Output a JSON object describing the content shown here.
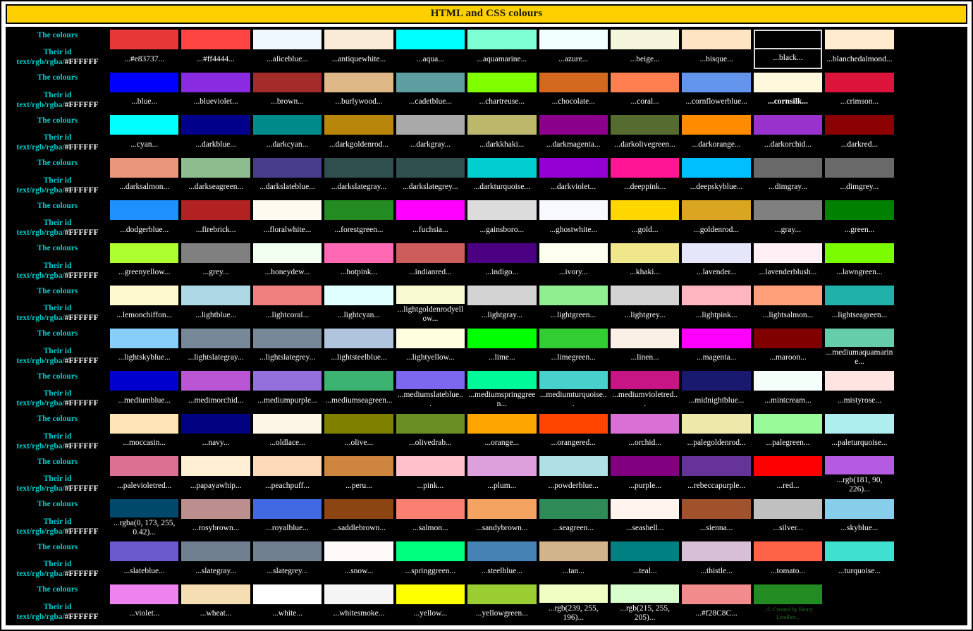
{
  "title": "HTML and CSS colours",
  "row_labels": {
    "line1": "The colours",
    "line2": "Their id",
    "line3_prefix": "text/rgb/rgba/",
    "line3_hex": "#FFFFFF"
  },
  "accents": {
    "title_bg": "#FFD000",
    "label_color": "#00CCCC",
    "table_bg": "#000000",
    "caption_color": "#FFFFFF",
    "selected_border": "#DDDDDD",
    "copyright_text_color": "#1e7a1e"
  },
  "columns_per_row": 12,
  "rows": [
    {
      "cells": [
        {
          "label": "...#e83737...",
          "color": "#e83737"
        },
        {
          "label": "...#ff4444...",
          "color": "#ff4444"
        },
        {
          "label": "...aliceblue...",
          "color": "#f0f8ff"
        },
        {
          "label": "...antiquewhite...",
          "color": "#faebd7"
        },
        {
          "label": "...aqua...",
          "color": "#00ffff"
        },
        {
          "label": "...aquamarine...",
          "color": "#7fffd4"
        },
        {
          "label": "...azure...",
          "color": "#f0ffff"
        },
        {
          "label": "...beige...",
          "color": "#f5f5dc"
        },
        {
          "label": "...bisque...",
          "color": "#ffe4c4"
        },
        {
          "label": "...black...",
          "color": "#000000",
          "selected": true
        },
        {
          "label": "...blanchedalmond...",
          "color": "#ffebcd"
        }
      ]
    },
    {
      "cells": [
        {
          "label": "...blue...",
          "color": "#0000ff"
        },
        {
          "label": "...blueviolet...",
          "color": "#8a2be2"
        },
        {
          "label": "...brown...",
          "color": "#a52a2a"
        },
        {
          "label": "...burlywood...",
          "color": "#deb887"
        },
        {
          "label": "...cadetblue...",
          "color": "#5f9ea0"
        },
        {
          "label": "...chartreuse...",
          "color": "#7fff00"
        },
        {
          "label": "...chocolate...",
          "color": "#d2691e"
        },
        {
          "label": "...coral...",
          "color": "#ff7f50"
        },
        {
          "label": "...cornflowerblue...",
          "color": "#6495ed"
        },
        {
          "label": "...cornsilk...",
          "color": "#fff8dc",
          "bold": true
        },
        {
          "label": "...crimson...",
          "color": "#dc143c"
        }
      ]
    },
    {
      "cells": [
        {
          "label": "...cyan...",
          "color": "#00ffff"
        },
        {
          "label": "...darkblue...",
          "color": "#00008b"
        },
        {
          "label": "...darkcyan...",
          "color": "#008b8b"
        },
        {
          "label": "...darkgoldenrod...",
          "color": "#b8860b"
        },
        {
          "label": "...darkgray...",
          "color": "#a9a9a9"
        },
        {
          "label": "...darkkhaki...",
          "color": "#bdb76b"
        },
        {
          "label": "...darkmagenta...",
          "color": "#8b008b"
        },
        {
          "label": "...darkolivegreen...",
          "color": "#556b2f"
        },
        {
          "label": "...darkorange...",
          "color": "#ff8c00"
        },
        {
          "label": "...darkorchid...",
          "color": "#9932cc"
        },
        {
          "label": "...darkred...",
          "color": "#8b0000"
        }
      ]
    },
    {
      "cells": [
        {
          "label": "...darksalmon...",
          "color": "#e9967a"
        },
        {
          "label": "...darkseagreen...",
          "color": "#8fbc8f"
        },
        {
          "label": "...darkslateblue...",
          "color": "#483d8b"
        },
        {
          "label": "...darkslategray...",
          "color": "#2f4f4f"
        },
        {
          "label": "...darkslategrey...",
          "color": "#2f4f4f"
        },
        {
          "label": "...darkturquoise...",
          "color": "#00ced1"
        },
        {
          "label": "...darkviolet...",
          "color": "#9400d3"
        },
        {
          "label": "...deeppink...",
          "color": "#ff1493"
        },
        {
          "label": "...deepskyblue...",
          "color": "#00bfff"
        },
        {
          "label": "...dimgray...",
          "color": "#696969"
        },
        {
          "label": "...dimgrey...",
          "color": "#696969"
        }
      ]
    },
    {
      "cells": [
        {
          "label": "...dodgerblue...",
          "color": "#1e90ff"
        },
        {
          "label": "...firebrick...",
          "color": "#b22222"
        },
        {
          "label": "...floralwhite...",
          "color": "#fffaf0"
        },
        {
          "label": "...forestgreen...",
          "color": "#228b22"
        },
        {
          "label": "...fuchsia...",
          "color": "#ff00ff"
        },
        {
          "label": "...gainsboro...",
          "color": "#dcdcdc"
        },
        {
          "label": "...ghostwhite...",
          "color": "#f8f8ff"
        },
        {
          "label": "...gold...",
          "color": "#ffd700"
        },
        {
          "label": "...goldenrod...",
          "color": "#daa520"
        },
        {
          "label": "...gray...",
          "color": "#808080"
        },
        {
          "label": "...green...",
          "color": "#008000"
        }
      ]
    },
    {
      "cells": [
        {
          "label": "...greenyellow...",
          "color": "#adff2f"
        },
        {
          "label": "...grey...",
          "color": "#808080"
        },
        {
          "label": "...honeydew...",
          "color": "#f0fff0"
        },
        {
          "label": "...hotpink...",
          "color": "#ff69b4"
        },
        {
          "label": "...indianred...",
          "color": "#cd5c5c"
        },
        {
          "label": "...indigo...",
          "color": "#4b0082"
        },
        {
          "label": "...ivory...",
          "color": "#fffff0"
        },
        {
          "label": "...khaki...",
          "color": "#f0e68c"
        },
        {
          "label": "...lavender...",
          "color": "#e6e6fa"
        },
        {
          "label": "...lavenderblush...",
          "color": "#fff0f5"
        },
        {
          "label": "...lawngreen...",
          "color": "#7cfc00"
        }
      ]
    },
    {
      "cells": [
        {
          "label": "...lemonchiffon...",
          "color": "#fffacd"
        },
        {
          "label": "...lightblue...",
          "color": "#add8e6"
        },
        {
          "label": "...lightcoral...",
          "color": "#f08080"
        },
        {
          "label": "...lightcyan...",
          "color": "#e0ffff"
        },
        {
          "label": "...lightgoldenrodyellow...",
          "color": "#fafad2"
        },
        {
          "label": "...lightgray...",
          "color": "#d3d3d3"
        },
        {
          "label": "...lightgreen...",
          "color": "#90ee90"
        },
        {
          "label": "...lightgrey...",
          "color": "#d3d3d3"
        },
        {
          "label": "...lightpink...",
          "color": "#ffb6c1"
        },
        {
          "label": "...lightsalmon...",
          "color": "#ffa07a"
        },
        {
          "label": "...lightseagreen...",
          "color": "#20b2aa"
        }
      ]
    },
    {
      "cells": [
        {
          "label": "...lightskyblue...",
          "color": "#87cefa"
        },
        {
          "label": "...lightslategray...",
          "color": "#778899"
        },
        {
          "label": "...lightslategrey...",
          "color": "#778899"
        },
        {
          "label": "...lightsteelblue...",
          "color": "#b0c4de"
        },
        {
          "label": "...lightyellow...",
          "color": "#ffffe0"
        },
        {
          "label": "...lime...",
          "color": "#00ff00"
        },
        {
          "label": "...limegreen...",
          "color": "#32cd32"
        },
        {
          "label": "...linen...",
          "color": "#faf0e6"
        },
        {
          "label": "...magenta...",
          "color": "#ff00ff"
        },
        {
          "label": "...maroon...",
          "color": "#800000"
        },
        {
          "label": "...mediumaquamarine...",
          "color": "#66cdaa"
        }
      ]
    },
    {
      "cells": [
        {
          "label": "...mediumblue...",
          "color": "#0000cd"
        },
        {
          "label": "...medimorchid...",
          "color": "#ba55d3"
        },
        {
          "label": "...mediumpurple...",
          "color": "#9370db"
        },
        {
          "label": "...mediumseagreen...",
          "color": "#3cb371"
        },
        {
          "label": "...mediumslateblue...",
          "color": "#7b68ee"
        },
        {
          "label": "...mediumspringgreen...",
          "color": "#00fa9a"
        },
        {
          "label": "...mediumturquoise...",
          "color": "#48d1cc"
        },
        {
          "label": "...mediumvioletred...",
          "color": "#c71585"
        },
        {
          "label": "...midnightblue...",
          "color": "#191970"
        },
        {
          "label": "...mintcream...",
          "color": "#f5fffa"
        },
        {
          "label": "...mistyrose...",
          "color": "#ffe4e1"
        }
      ]
    },
    {
      "cells": [
        {
          "label": "...moccasin...",
          "color": "#ffe4b5"
        },
        {
          "label": "...navy...",
          "color": "#000080"
        },
        {
          "label": "...oldlace...",
          "color": "#fdf5e6"
        },
        {
          "label": "...olive...",
          "color": "#808000"
        },
        {
          "label": "...olivedrab...",
          "color": "#6b8e23"
        },
        {
          "label": "...orange...",
          "color": "#ffa500"
        },
        {
          "label": "...orangered...",
          "color": "#ff4500"
        },
        {
          "label": "...orchid...",
          "color": "#da70d6"
        },
        {
          "label": "...palegoldenrod...",
          "color": "#eee8aa"
        },
        {
          "label": "...palegreen...",
          "color": "#98fb98"
        },
        {
          "label": "...paleturquoise...",
          "color": "#afeeee"
        }
      ]
    },
    {
      "cells": [
        {
          "label": "...palevioletred...",
          "color": "#db7093"
        },
        {
          "label": "...papayawhip...",
          "color": "#ffefd5"
        },
        {
          "label": "...peachpuff...",
          "color": "#ffdab9"
        },
        {
          "label": "...peru...",
          "color": "#cd853f"
        },
        {
          "label": "...pink...",
          "color": "#ffc0cb"
        },
        {
          "label": "...plum...",
          "color": "#dda0dd"
        },
        {
          "label": "...powderblue...",
          "color": "#b0e0e6"
        },
        {
          "label": "...purple...",
          "color": "#800080"
        },
        {
          "label": "...rebeccapurple...",
          "color": "#663399"
        },
        {
          "label": "...red...",
          "color": "#ff0000"
        },
        {
          "label": "...rgb(181, 90, 226)...",
          "color": "#b55ae2"
        }
      ]
    },
    {
      "cells": [
        {
          "label": "...rgba(0, 173, 255, 0.42)...",
          "color": "rgba(0, 173, 255, 0.42)"
        },
        {
          "label": "...rosybrown...",
          "color": "#bc8f8f"
        },
        {
          "label": "...royalblue...",
          "color": "#4169e1"
        },
        {
          "label": "...saddlebrown...",
          "color": "#8b4513"
        },
        {
          "label": "...salmon...",
          "color": "#fa8072"
        },
        {
          "label": "...sandybrown...",
          "color": "#f4a460"
        },
        {
          "label": "...seagreen...",
          "color": "#2e8b57"
        },
        {
          "label": "...seashell...",
          "color": "#fff5ee"
        },
        {
          "label": "...sienna...",
          "color": "#a0522d"
        },
        {
          "label": "...silver...",
          "color": "#c0c0c0"
        },
        {
          "label": "...skyblue...",
          "color": "#87ceeb"
        }
      ]
    },
    {
      "cells": [
        {
          "label": "...slateblue...",
          "color": "#6a5acd"
        },
        {
          "label": "...slategray...",
          "color": "#708090"
        },
        {
          "label": "...slategrey...",
          "color": "#708090"
        },
        {
          "label": "...snow...",
          "color": "#fffafa"
        },
        {
          "label": "...springgreen...",
          "color": "#00ff7f"
        },
        {
          "label": "...steelblue...",
          "color": "#4682b4"
        },
        {
          "label": "...tan...",
          "color": "#d2b48c"
        },
        {
          "label": "...teal...",
          "color": "#008080"
        },
        {
          "label": "...thistle...",
          "color": "#d8bfd8"
        },
        {
          "label": "...tomato...",
          "color": "#ff6347"
        },
        {
          "label": "...turquoise...",
          "color": "#40e0d0"
        }
      ]
    },
    {
      "cells": [
        {
          "label": "...violet...",
          "color": "#ee82ee"
        },
        {
          "label": "...wheat...",
          "color": "#f5deb3"
        },
        {
          "label": "...white...",
          "color": "#ffffff"
        },
        {
          "label": "...whitesmoke...",
          "color": "#f5f5f5"
        },
        {
          "label": "...yellow...",
          "color": "#ffff00"
        },
        {
          "label": "...yellowgreen...",
          "color": "#9acd32"
        },
        {
          "label": "...rgb(239, 255, 196)...",
          "color": "#efffc4"
        },
        {
          "label": "...rgb(215, 255, 205)...",
          "color": "#d7ffcd"
        },
        {
          "label": "...#f28C8C...",
          "color": "#f28C8C"
        },
        {
          "label": "...© Created by Henry Letellier...",
          "color": "#228b22",
          "tiny": true,
          "text_color": "#1e7a1e"
        },
        {
          "label": "",
          "color": null,
          "empty": true
        }
      ]
    }
  ]
}
